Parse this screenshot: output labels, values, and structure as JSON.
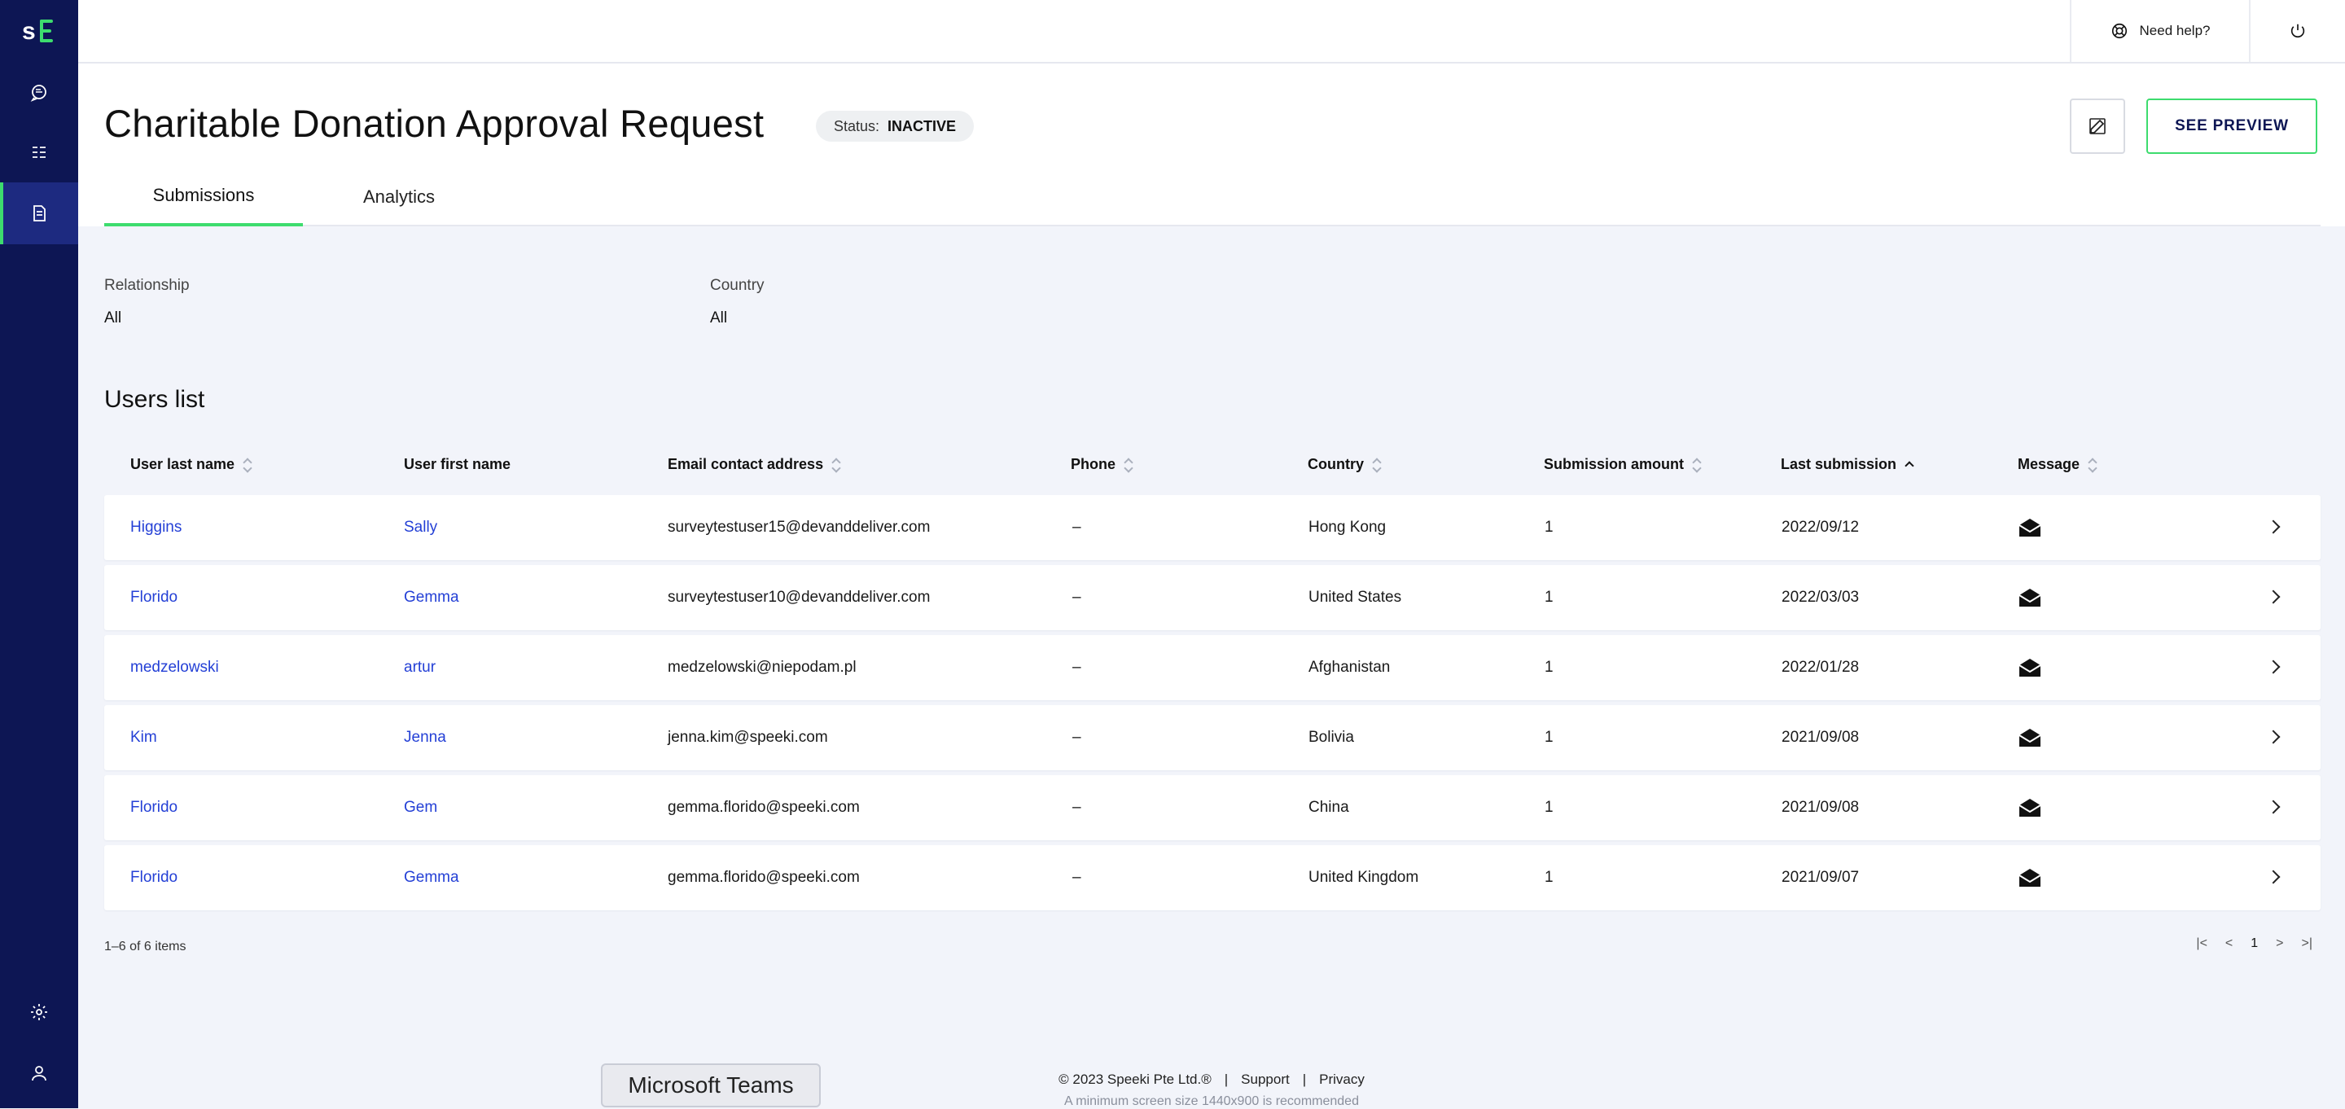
{
  "sidebar": {
    "logo": "speeki-logo",
    "items": [
      {
        "icon": "chat-icon"
      },
      {
        "icon": "list-icon"
      },
      {
        "icon": "form-icon",
        "active": true
      },
      {
        "icon": "gear-icon"
      },
      {
        "icon": "user-icon"
      }
    ],
    "accent": "#3ddc6e",
    "background": "#0d1654"
  },
  "topbar": {
    "help_label": "Need help?"
  },
  "header": {
    "title": "Charitable Donation Approval Request",
    "status_key": "Status:",
    "status_value": "INACTIVE",
    "preview_label": "SEE PREVIEW"
  },
  "tabs": [
    {
      "label": "Submissions",
      "active": true
    },
    {
      "label": "Analytics",
      "active": false
    }
  ],
  "filters": {
    "relationship": {
      "label": "Relationship",
      "value": "All"
    },
    "country": {
      "label": "Country",
      "value": "All"
    }
  },
  "users_list": {
    "title": "Users list",
    "columns": [
      "User last name",
      "User first name",
      "Email contact address",
      "Phone",
      "Country",
      "Submission amount",
      "Last submission",
      "Message"
    ],
    "rows": [
      {
        "last": "Higgins",
        "first": "Sally",
        "email": "surveytestuser15@devanddeliver.com",
        "phone": "–",
        "country": "Hong Kong",
        "amount": "1",
        "last_submission": "2022/09/12"
      },
      {
        "last": "Florido",
        "first": "Gemma",
        "email": "surveytestuser10@devanddeliver.com",
        "phone": "–",
        "country": "United States",
        "amount": "1",
        "last_submission": "2022/03/03"
      },
      {
        "last": "medzelowski",
        "first": "artur",
        "email": "medzelowski@niepodam.pl",
        "phone": "–",
        "country": "Afghanistan",
        "amount": "1",
        "last_submission": "2022/01/28"
      },
      {
        "last": "Kim",
        "first": "Jenna",
        "email": "jenna.kim@speeki.com",
        "phone": "–",
        "country": "Bolivia",
        "amount": "1",
        "last_submission": "2021/09/08"
      },
      {
        "last": "Florido",
        "first": "Gem",
        "email": "gemma.florido@speeki.com",
        "phone": "–",
        "country": "China",
        "amount": "1",
        "last_submission": "2021/09/08"
      },
      {
        "last": "Florido",
        "first": "Gemma",
        "email": "gemma.florido@speeki.com",
        "phone": "–",
        "country": "United Kingdom",
        "amount": "1",
        "last_submission": "2021/09/07"
      }
    ],
    "pagination_info": "1–6 of 6 items",
    "current_page": "1"
  },
  "footer": {
    "copyright": "© 2023 Speeki Pte Ltd.®",
    "sep1": "|",
    "support": "Support",
    "sep2": "|",
    "privacy": "Privacy",
    "note": "A minimum screen size 1440x900 is recommended"
  },
  "teams_tooltip": "Microsoft Teams"
}
